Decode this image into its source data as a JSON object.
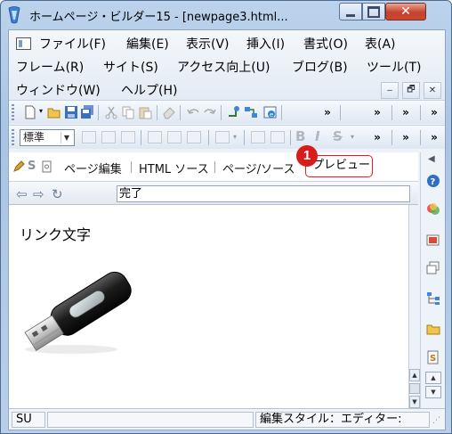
{
  "window": {
    "title": "ホームページ・ビルダー15 - [newpage3.html...",
    "close_glyph": "✕"
  },
  "menu": {
    "items": [
      {
        "label": "ファイル(F)"
      },
      {
        "label": "編集(E)"
      },
      {
        "label": "表示(V)"
      },
      {
        "label": "挿入(I)"
      },
      {
        "label": "書式(O)"
      },
      {
        "label": "表(A)"
      },
      {
        "label": "フレーム(R)"
      },
      {
        "label": "サイト(S)"
      },
      {
        "label": "アクセス向上(U)"
      },
      {
        "label": "ブログ(B)"
      },
      {
        "label": "ツール(T)"
      },
      {
        "label": "ウィンドウ(W)"
      },
      {
        "label": "ヘルプ(H)"
      }
    ],
    "mdi_buttons": [
      "‒",
      "🗗",
      "✕"
    ]
  },
  "toolbar": {
    "overflow_glyph": "»",
    "style_value": "標準"
  },
  "editor_tabs": {
    "s_label": "S",
    "items": [
      {
        "label": "ページ編集"
      },
      {
        "label": "HTML ソース"
      },
      {
        "label": "ページ/ソース"
      },
      {
        "label": "プレビュー"
      }
    ],
    "callout_number": "1"
  },
  "preview": {
    "address_text": "完了",
    "body_text": "リンク文字"
  },
  "statusbar": {
    "left": "SU",
    "right": "編集スタイル：エディター:"
  },
  "colors": {
    "accent": "#d91b1b",
    "title_bar": "#a9c4e4"
  }
}
